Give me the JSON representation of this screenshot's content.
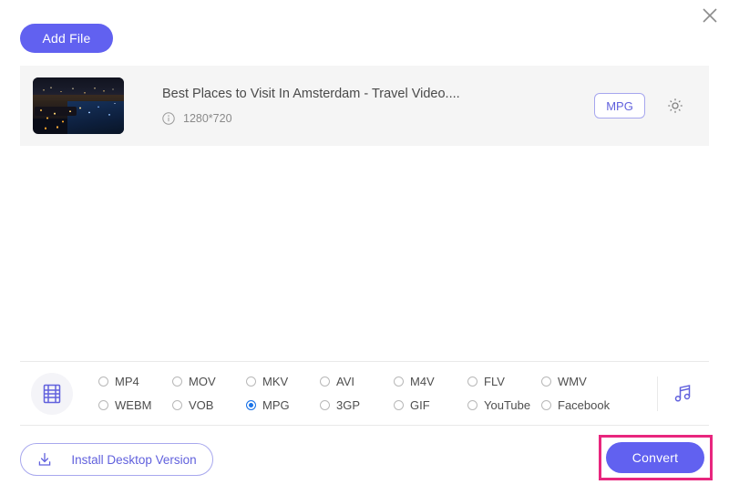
{
  "window": {
    "close_label": "×",
    "close_icon": "close-icon"
  },
  "toolbar": {
    "add_file_label": "Add File"
  },
  "files": [
    {
      "title": "Best Places to Visit In Amsterdam - Travel Video....",
      "resolution": "1280*720",
      "info_icon": "info-circle-icon",
      "output_format": "MPG",
      "settings_icon": "gear-icon",
      "thumbnail_alt": "Amsterdam city at night"
    }
  ],
  "formats": {
    "video_icon": "film-strip-icon",
    "audio_icon": "music-note-icon",
    "selected": "MPG",
    "options": [
      "MP4",
      "MOV",
      "MKV",
      "AVI",
      "M4V",
      "FLV",
      "WMV",
      "WEBM",
      "VOB",
      "MPG",
      "3GP",
      "GIF",
      "YouTube",
      "Facebook"
    ]
  },
  "footer": {
    "install_label": "Install Desktop Version",
    "install_icon": "download-icon",
    "convert_label": "Convert"
  },
  "colors": {
    "accent_purple": "#6161f0",
    "badge_border": "#a6a6ee",
    "radio_selected": "#1a73e8",
    "highlight_pink": "#e8267e",
    "row_background": "#f5f5f5"
  }
}
